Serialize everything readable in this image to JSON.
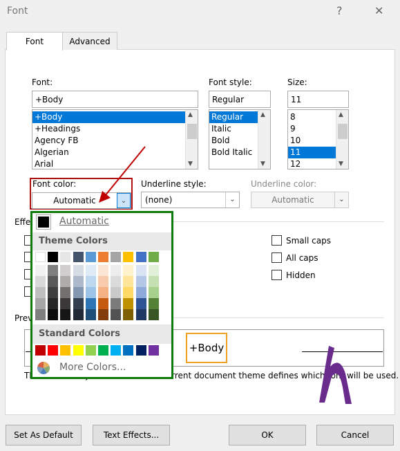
{
  "dialog": {
    "title": "Font",
    "help": "?",
    "close": "✕"
  },
  "tabs": [
    {
      "label": "Font",
      "active": true
    },
    {
      "label": "Advanced",
      "active": false
    }
  ],
  "font": {
    "label": "Font:",
    "value": "+Body",
    "items": [
      "+Body",
      "+Headings",
      "Agency FB",
      "Algerian",
      "Arial"
    ],
    "selected": 0
  },
  "style": {
    "label": "Font style:",
    "value": "Regular",
    "items": [
      "Regular",
      "Italic",
      "Bold",
      "Bold Italic"
    ],
    "selected": 0
  },
  "size": {
    "label": "Size:",
    "value": "11",
    "items": [
      "8",
      "9",
      "10",
      "11",
      "12"
    ],
    "selected": 3
  },
  "font_color": {
    "label": "Font color:",
    "value": "Automatic"
  },
  "underline_style": {
    "label": "Underline style:",
    "value": "(none)"
  },
  "underline_color": {
    "label": "Underline color:",
    "value": "Automatic"
  },
  "effects": {
    "label": "Effects",
    "options": [
      {
        "label": "Small caps",
        "checked": false
      },
      {
        "label": "All caps",
        "checked": false
      },
      {
        "label": "Hidden",
        "checked": false
      }
    ]
  },
  "preview": {
    "label": "Preview",
    "sample": "+Body",
    "note": "This is the body theme font. The current document theme defines which font will be used."
  },
  "color_picker": {
    "automatic": "Automatic",
    "theme_header": "Theme Colors",
    "theme_colors": [
      "#ffffff",
      "#000000",
      "#e7e6e6",
      "#44546a",
      "#5b9bd5",
      "#ed7d31",
      "#a5a5a5",
      "#ffc000",
      "#4472c4",
      "#70ad47"
    ],
    "theme_shades": [
      [
        "#f2f2f2",
        "#d9d9d9",
        "#bfbfbf",
        "#a6a6a6",
        "#7f7f7f"
      ],
      [
        "#7f7f7f",
        "#595959",
        "#3f3f3f",
        "#262626",
        "#0d0d0d"
      ],
      [
        "#d0cece",
        "#aeabab",
        "#757070",
        "#3a3838",
        "#171616"
      ],
      [
        "#d6dce4",
        "#adb9ca",
        "#8497b0",
        "#333f4f",
        "#222a35"
      ],
      [
        "#deebf6",
        "#bdd7ee",
        "#9dc3e6",
        "#2e75b5",
        "#1f4e79"
      ],
      [
        "#fbe5d5",
        "#f7cbac",
        "#f4b183",
        "#c55a11",
        "#833c0b"
      ],
      [
        "#ededed",
        "#dbdbdb",
        "#c9c9c9",
        "#7b7b7b",
        "#525252"
      ],
      [
        "#fff2cc",
        "#fee599",
        "#ffd965",
        "#bf9000",
        "#7f6000"
      ],
      [
        "#dae3f3",
        "#b4c7e7",
        "#8eaadb",
        "#2f5496",
        "#1f3864"
      ],
      [
        "#e2efd9",
        "#c5e0b3",
        "#a8d08d",
        "#538135",
        "#375623"
      ]
    ],
    "standard_header": "Standard Colors",
    "standard_colors": [
      "#c00000",
      "#ff0000",
      "#ffc000",
      "#ffff00",
      "#92d050",
      "#00b050",
      "#00b0f0",
      "#0070c0",
      "#002060",
      "#7030a0"
    ],
    "more_colors": "More Colors..."
  },
  "buttons": {
    "set_default": "Set As Default",
    "text_effects": "Text Effects...",
    "ok": "OK",
    "cancel": "Cancel"
  },
  "annotation_colors": {
    "arrow": "#c00000",
    "highlight_popup": "#0e7a0e",
    "logo": "#6a2c8c"
  }
}
